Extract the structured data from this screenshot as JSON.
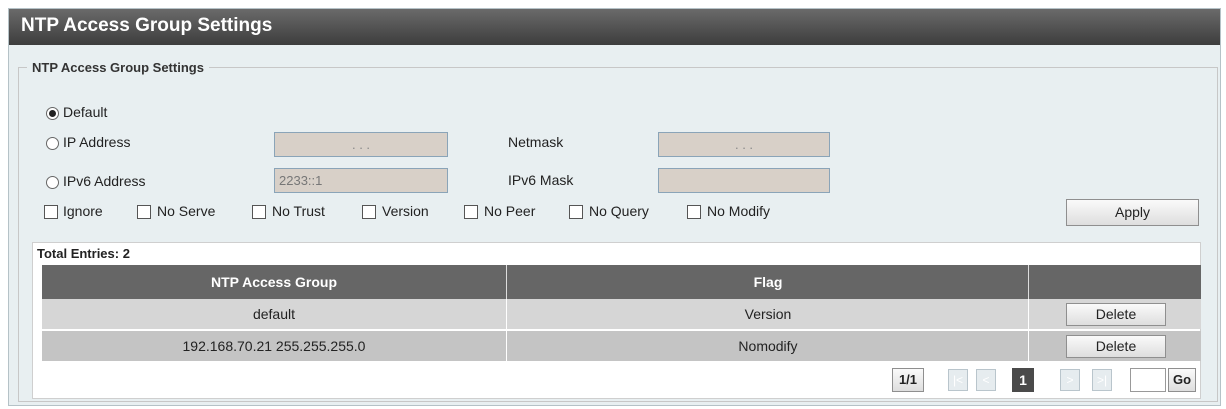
{
  "page": {
    "title": "NTP Access Group Settings"
  },
  "form": {
    "legend": "NTP Access Group Settings",
    "radio_default": "Default",
    "radio_ip": "IP Address",
    "radio_ipv6": "IPv6 Address",
    "ip_value": ".     .     .",
    "netmask_label": "Netmask",
    "netmask_value": ".     .     .",
    "ipv6_value": "2233::1",
    "ipv6_mask_label": "IPv6 Mask",
    "ipv6_mask_value": "",
    "flags": [
      "Ignore",
      "No Serve",
      "No Trust",
      "Version",
      "No Peer",
      "No Query",
      "No Modify"
    ],
    "apply_label": "Apply"
  },
  "table": {
    "total": "Total Entries: 2",
    "columns": [
      "NTP Access Group",
      "Flag",
      ""
    ],
    "rows": [
      {
        "group": "default",
        "flag": "Version",
        "action": "Delete"
      },
      {
        "group": "192.168.70.21 255.255.255.0",
        "flag": "Nomodify",
        "action": "Delete"
      }
    ]
  },
  "pager": {
    "page_info": "1/1",
    "first": "|<",
    "prev": "<",
    "current": "1",
    "next": ">",
    "last": ">|",
    "go_label": "Go",
    "go_value": ""
  }
}
